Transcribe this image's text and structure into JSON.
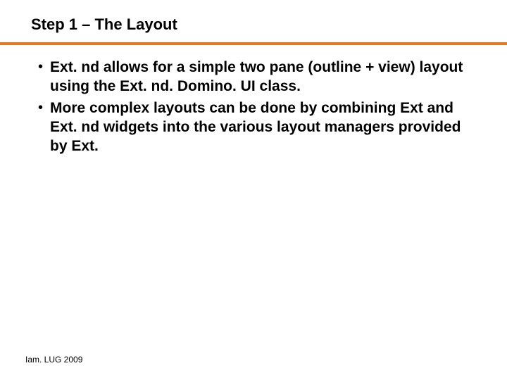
{
  "slide": {
    "title": "Step 1 – The Layout",
    "bullets": [
      "Ext. nd allows for a simple two pane (outline + view) layout using the Ext. nd. Domino. UI class.",
      "More complex layouts can be done by combining Ext and Ext. nd widgets into the various layout managers provided by Ext."
    ],
    "footer": "Iam. LUG 2009"
  },
  "colors": {
    "accent": "#e87722"
  }
}
